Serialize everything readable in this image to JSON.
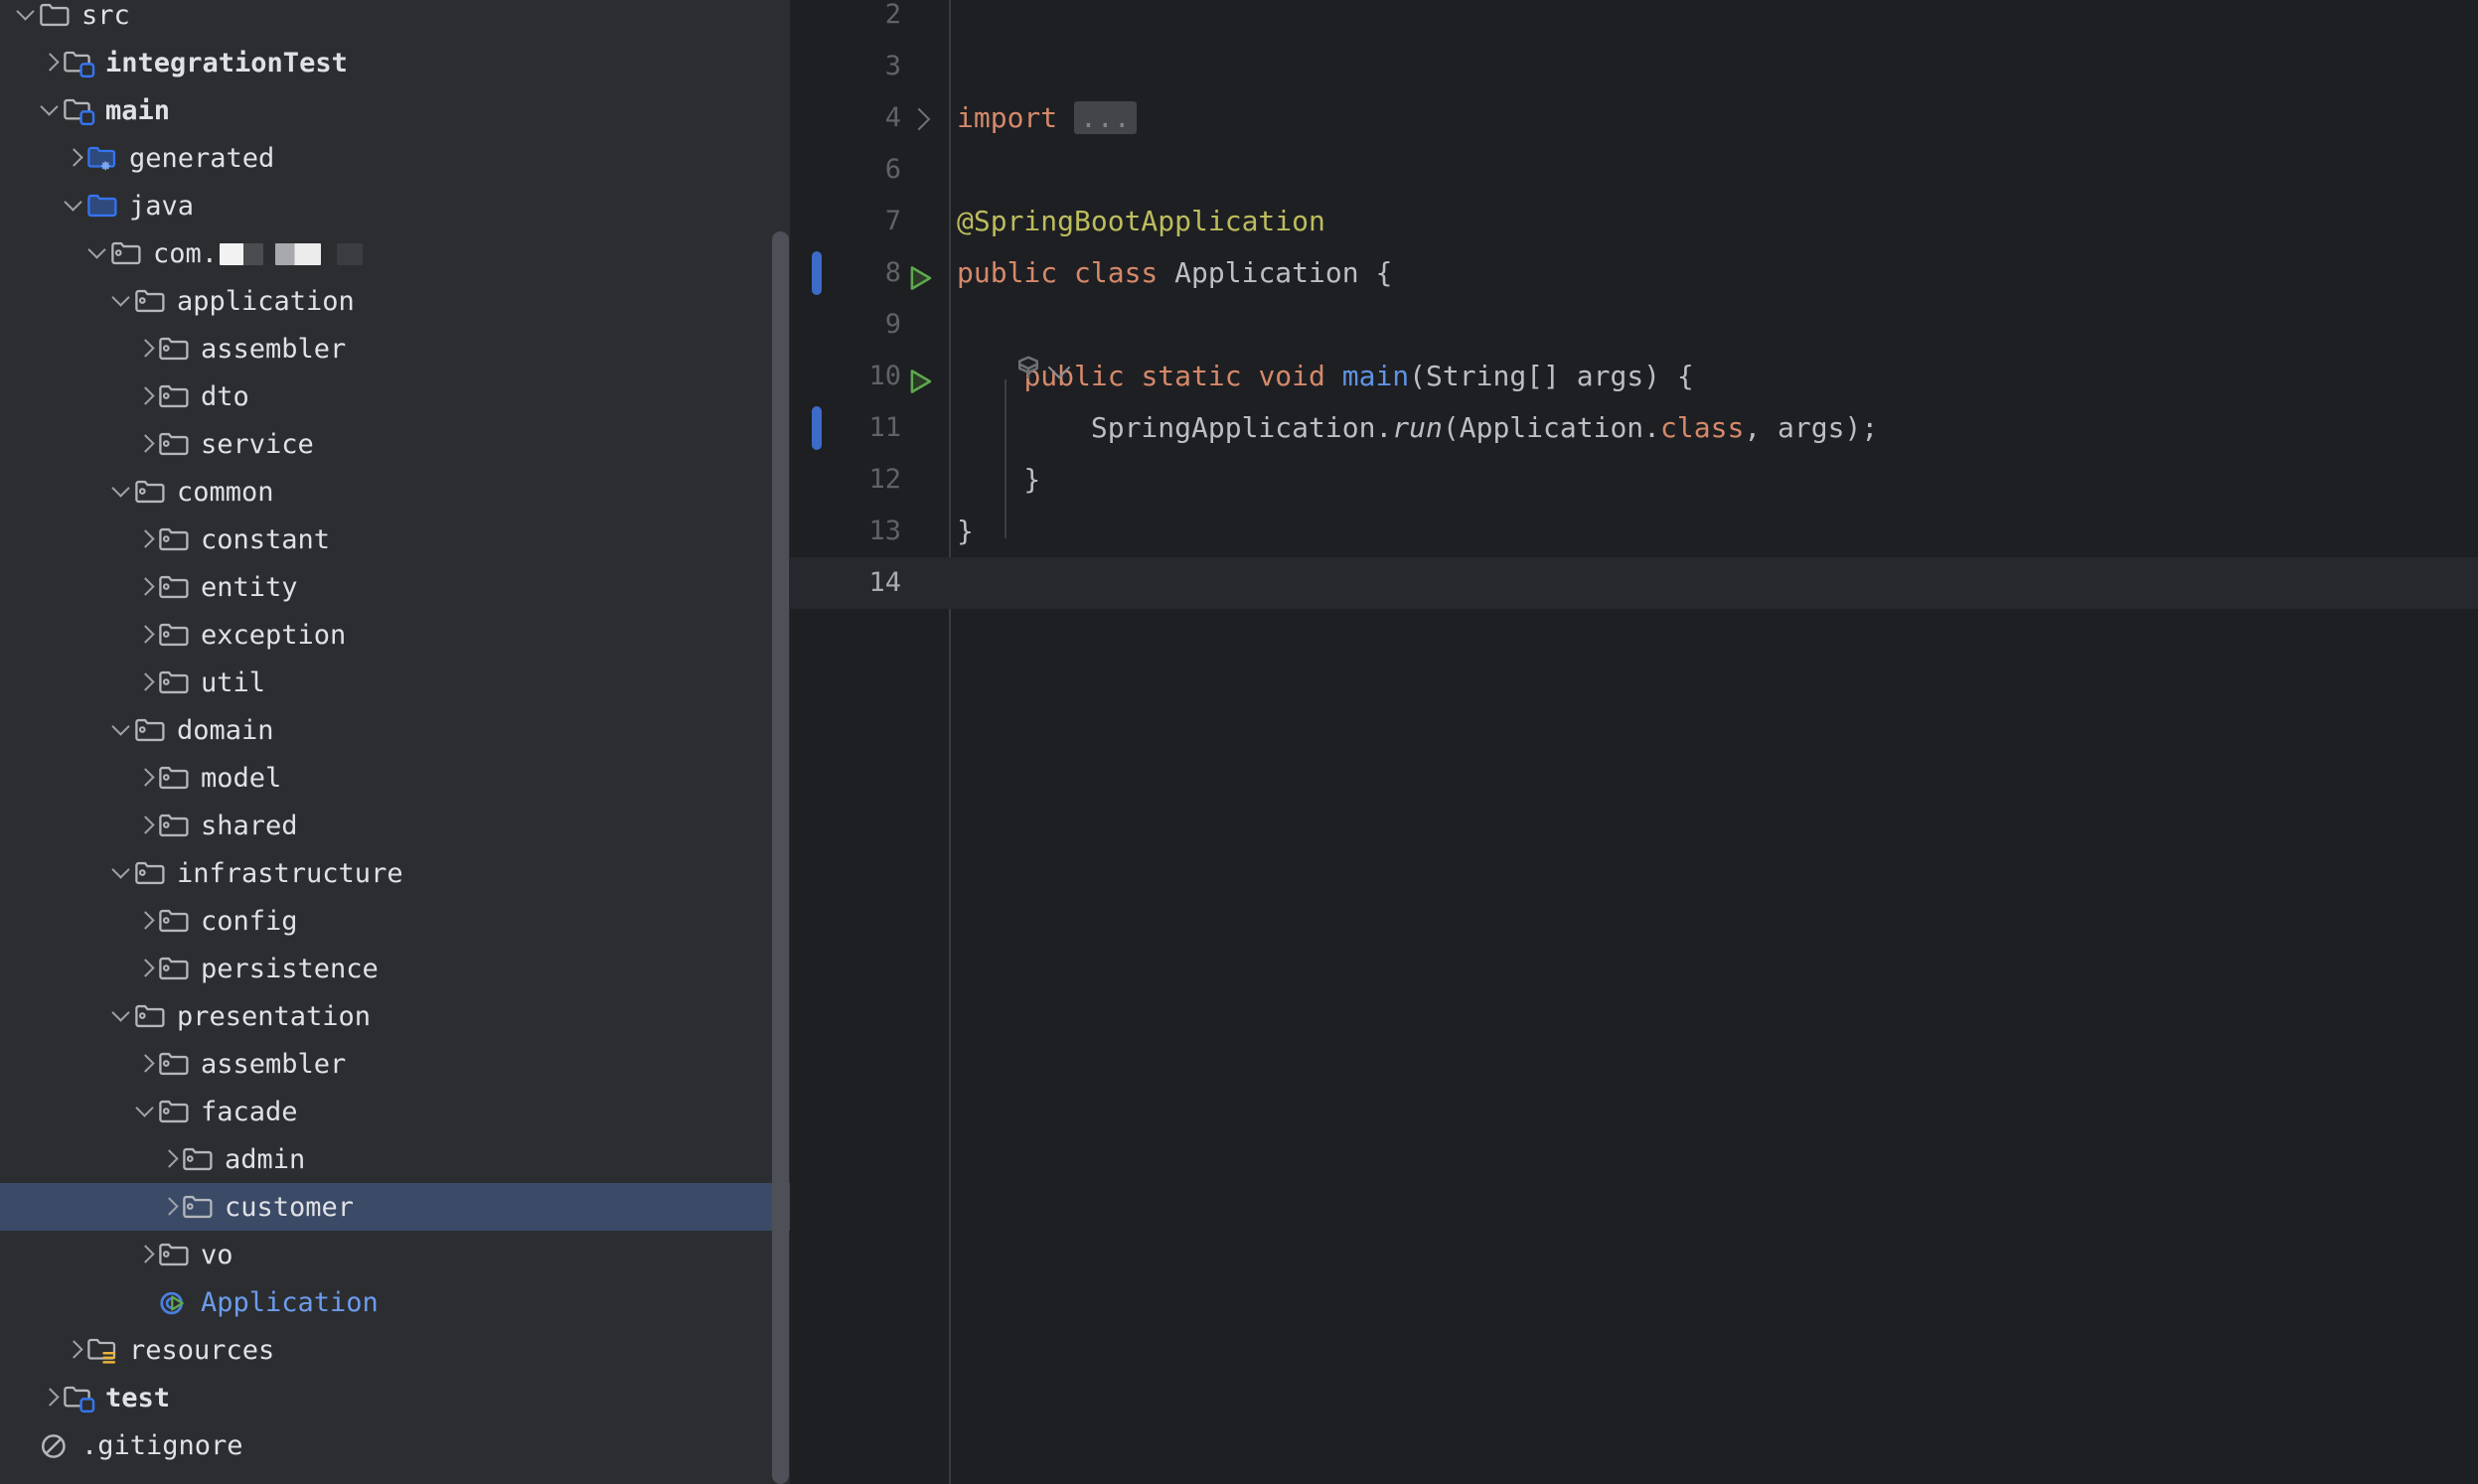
{
  "theme": {
    "panel_bg": "#2b2d30",
    "editor_bg": "#1e1f22",
    "selection_bg": "#3b4a66",
    "current_line_bg": "#26282e",
    "text": "#dfe1e5",
    "code_text": "#bcbec4",
    "keyword": "#d5896a",
    "annotation": "#bcbc5e",
    "method": "#5f94e3",
    "line_number": "#606366",
    "change_marker": "#3d6cc8",
    "run_green": "#499c54",
    "link_blue": "#6c9ced"
  },
  "project_tree": {
    "name": "project-tool-window",
    "scrollbar": {
      "name": "tree-scrollbar"
    },
    "items": [
      {
        "label": "src",
        "indent": 0,
        "arrow": "down",
        "icon": "folder",
        "bold": false,
        "selected": false
      },
      {
        "label": "integrationTest",
        "indent": 1,
        "arrow": "right",
        "icon": "module-folder",
        "bold": true,
        "selected": false
      },
      {
        "label": "main",
        "indent": 1,
        "arrow": "down",
        "icon": "module-folder",
        "bold": true,
        "selected": false
      },
      {
        "label": "generated",
        "indent": 2,
        "arrow": "right",
        "icon": "generated-folder",
        "bold": false,
        "selected": false
      },
      {
        "label": "java",
        "indent": 2,
        "arrow": "down",
        "icon": "source-folder",
        "bold": false,
        "selected": false
      },
      {
        "label": "com.",
        "indent": 3,
        "arrow": "down",
        "icon": "package",
        "bold": false,
        "selected": false,
        "redacted": true
      },
      {
        "label": "application",
        "indent": 4,
        "arrow": "down",
        "icon": "package",
        "bold": false,
        "selected": false
      },
      {
        "label": "assembler",
        "indent": 5,
        "arrow": "right",
        "icon": "package",
        "bold": false,
        "selected": false
      },
      {
        "label": "dto",
        "indent": 5,
        "arrow": "right",
        "icon": "package",
        "bold": false,
        "selected": false
      },
      {
        "label": "service",
        "indent": 5,
        "arrow": "right",
        "icon": "package",
        "bold": false,
        "selected": false
      },
      {
        "label": "common",
        "indent": 4,
        "arrow": "down",
        "icon": "package",
        "bold": false,
        "selected": false
      },
      {
        "label": "constant",
        "indent": 5,
        "arrow": "right",
        "icon": "package",
        "bold": false,
        "selected": false
      },
      {
        "label": "entity",
        "indent": 5,
        "arrow": "right",
        "icon": "package",
        "bold": false,
        "selected": false
      },
      {
        "label": "exception",
        "indent": 5,
        "arrow": "right",
        "icon": "package",
        "bold": false,
        "selected": false
      },
      {
        "label": "util",
        "indent": 5,
        "arrow": "right",
        "icon": "package",
        "bold": false,
        "selected": false
      },
      {
        "label": "domain",
        "indent": 4,
        "arrow": "down",
        "icon": "package",
        "bold": false,
        "selected": false
      },
      {
        "label": "model",
        "indent": 5,
        "arrow": "right",
        "icon": "package",
        "bold": false,
        "selected": false
      },
      {
        "label": "shared",
        "indent": 5,
        "arrow": "right",
        "icon": "package",
        "bold": false,
        "selected": false
      },
      {
        "label": "infrastructure",
        "indent": 4,
        "arrow": "down",
        "icon": "package",
        "bold": false,
        "selected": false
      },
      {
        "label": "config",
        "indent": 5,
        "arrow": "right",
        "icon": "package",
        "bold": false,
        "selected": false
      },
      {
        "label": "persistence",
        "indent": 5,
        "arrow": "right",
        "icon": "package",
        "bold": false,
        "selected": false
      },
      {
        "label": "presentation",
        "indent": 4,
        "arrow": "down",
        "icon": "package",
        "bold": false,
        "selected": false
      },
      {
        "label": "assembler",
        "indent": 5,
        "arrow": "right",
        "icon": "package",
        "bold": false,
        "selected": false
      },
      {
        "label": "facade",
        "indent": 5,
        "arrow": "down",
        "icon": "package",
        "bold": false,
        "selected": false
      },
      {
        "label": "admin",
        "indent": 6,
        "arrow": "right",
        "icon": "package",
        "bold": false,
        "selected": false
      },
      {
        "label": "customer",
        "indent": 6,
        "arrow": "right",
        "icon": "package",
        "bold": false,
        "selected": true
      },
      {
        "label": "vo",
        "indent": 5,
        "arrow": "right",
        "icon": "package",
        "bold": false,
        "selected": false
      },
      {
        "label": "Application",
        "indent": 5,
        "arrow": "none",
        "icon": "java-runnable",
        "bold": false,
        "selected": false,
        "blue": true
      },
      {
        "label": "resources",
        "indent": 2,
        "arrow": "right",
        "icon": "resources-folder",
        "bold": false,
        "selected": false
      },
      {
        "label": "test",
        "indent": 1,
        "arrow": "right",
        "icon": "module-folder",
        "bold": true,
        "selected": false
      },
      {
        "label": ".gitignore",
        "indent": 0,
        "arrow": "none",
        "icon": "ignored-file",
        "bold": false,
        "selected": false
      }
    ]
  },
  "editor": {
    "name": "code-editor",
    "spring_hint": {
      "icon": "spring-boot-icon",
      "chevron": "chevron-down-icon"
    },
    "lines": [
      {
        "number": "2",
        "tokens": [],
        "run": false,
        "change": false,
        "fold": false,
        "current": false
      },
      {
        "number": "3",
        "tokens": [],
        "run": false,
        "change": false,
        "fold": false,
        "current": false
      },
      {
        "number": "4",
        "tokens": [
          {
            "t": "import ",
            "c": "kw"
          },
          {
            "t": "...",
            "c": "fold-ellipsis"
          }
        ],
        "run": false,
        "change": false,
        "fold": true,
        "current": false
      },
      {
        "number": "6",
        "tokens": [],
        "run": false,
        "change": false,
        "fold": false,
        "current": false
      },
      {
        "number": "7",
        "tokens": [
          {
            "t": "@SpringBootApplication",
            "c": "ann"
          }
        ],
        "run": false,
        "change": false,
        "fold": false,
        "current": false
      },
      {
        "number": "8",
        "tokens": [
          {
            "t": "public class ",
            "c": "kw"
          },
          {
            "t": "Application {",
            "c": ""
          }
        ],
        "run": true,
        "change": true,
        "fold": false,
        "current": false
      },
      {
        "number": "9",
        "tokens": [],
        "run": false,
        "change": false,
        "fold": false,
        "current": false
      },
      {
        "number": "10",
        "tokens": [
          {
            "t": "    ",
            "c": ""
          },
          {
            "t": "public static void ",
            "c": "kw"
          },
          {
            "t": "main",
            "c": "meth"
          },
          {
            "t": "(String[] args) {",
            "c": ""
          }
        ],
        "run": true,
        "change": false,
        "fold": false,
        "current": false
      },
      {
        "number": "11",
        "tokens": [
          {
            "t": "        SpringApplication.",
            "c": ""
          },
          {
            "t": "run",
            "c": "ital"
          },
          {
            "t": "(Application.",
            "c": ""
          },
          {
            "t": "class",
            "c": "kw"
          },
          {
            "t": ", args);",
            "c": ""
          }
        ],
        "run": false,
        "change": true,
        "fold": false,
        "current": false
      },
      {
        "number": "12",
        "tokens": [
          {
            "t": "    }",
            "c": ""
          }
        ],
        "run": false,
        "change": false,
        "fold": false,
        "current": false
      },
      {
        "number": "13",
        "tokens": [
          {
            "t": "}",
            "c": ""
          }
        ],
        "run": false,
        "change": false,
        "fold": false,
        "current": false
      },
      {
        "number": "14",
        "tokens": [],
        "run": false,
        "change": false,
        "fold": false,
        "current": true
      }
    ]
  }
}
